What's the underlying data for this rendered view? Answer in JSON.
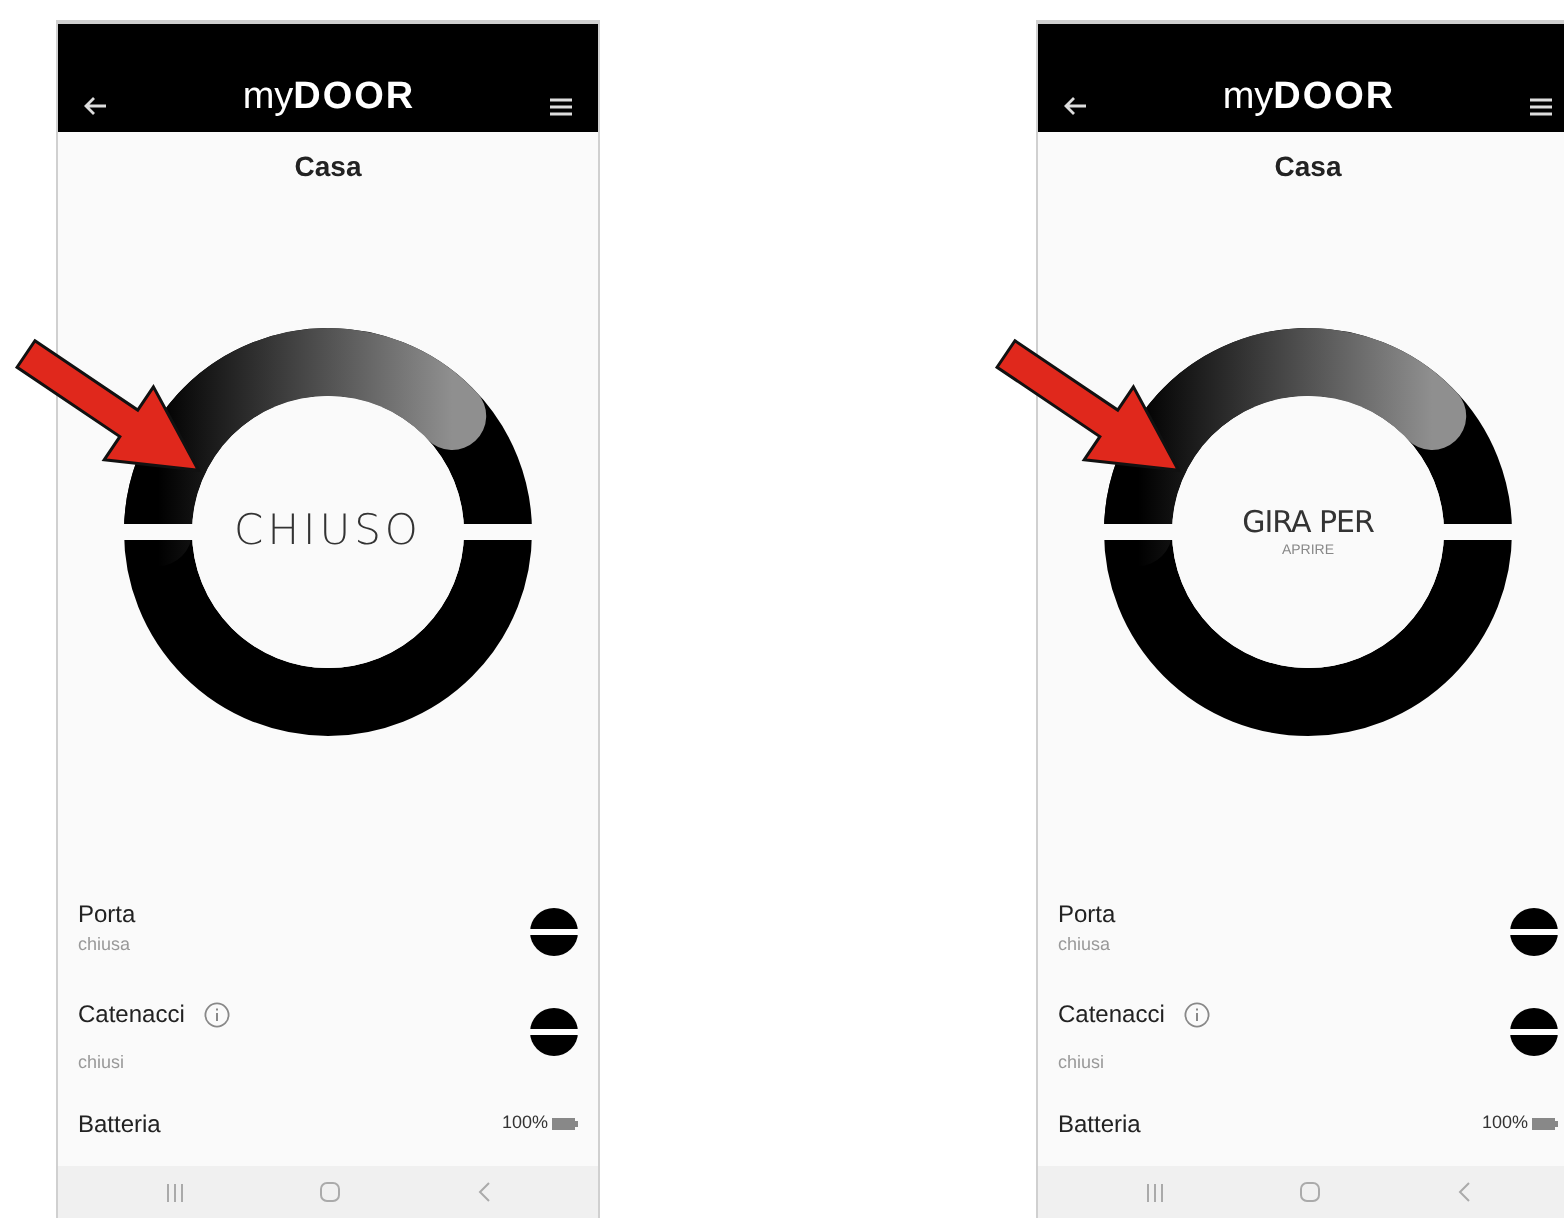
{
  "phones": [
    {
      "header": {
        "logo_prefix": "my",
        "logo_main": "DOOR"
      },
      "title": "Casa",
      "dial": {
        "label": "CHIUSO"
      },
      "items": [
        {
          "kind": "lock",
          "label": "Porta",
          "value": "chiusa",
          "info": false
        },
        {
          "kind": "lock",
          "label": "Catenacci",
          "value": "chiusi",
          "info": true
        },
        {
          "kind": "battery",
          "label": "Batteria",
          "value": "100%",
          "info": false
        }
      ]
    },
    {
      "header": {
        "logo_prefix": "my",
        "logo_main": "DOOR"
      },
      "title": "Casa",
      "dial": {
        "label": "GIRA PER",
        "sublabel": "APRIRE"
      },
      "items": [
        {
          "kind": "lock",
          "label": "Porta",
          "value": "chiusa",
          "info": false
        },
        {
          "kind": "lock",
          "label": "Catenacci",
          "value": "chiusi",
          "info": true
        },
        {
          "kind": "battery",
          "label": "Batteria",
          "value": "100%",
          "info": false
        }
      ]
    }
  ]
}
